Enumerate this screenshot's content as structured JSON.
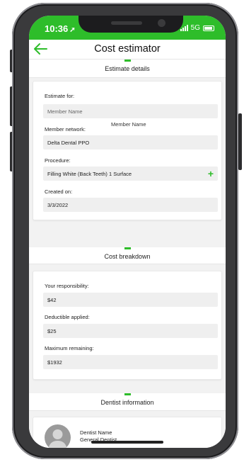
{
  "status": {
    "time": "10:36",
    "network": "5G"
  },
  "header": {
    "title": "Cost estimator"
  },
  "estimate_details": {
    "title": "Estimate details",
    "estimate_for_label": "Estimate for:",
    "member_name_placeholder": "Member Name",
    "member_network_label": "Member network:",
    "member_name_value": "Member Name",
    "network_value": "Delta Dental PPO",
    "procedure_label": "Procedure:",
    "procedure_value": "Filling White (Back Teeth) 1 Surface",
    "created_label": "Created on:",
    "created_value": "3/3/2022"
  },
  "cost_breakdown": {
    "title": "Cost breakdown",
    "responsibility_label": "Your responsibility:",
    "responsibility_value": "$42",
    "deductible_label": "Deductible applied:",
    "deductible_value": "$25",
    "maximum_label": "Maximum remaining:",
    "maximum_value": "$1932"
  },
  "dentist": {
    "title": "Dentist information",
    "name": "Dentist Name",
    "type": "General Dentist"
  },
  "colors": {
    "accent": "#2ebd2a",
    "background": "#f2f2f2",
    "field": "#efefef"
  },
  "icons": {
    "back": "arrow-left-icon",
    "add": "plus-icon",
    "avatar": "person-icon"
  }
}
